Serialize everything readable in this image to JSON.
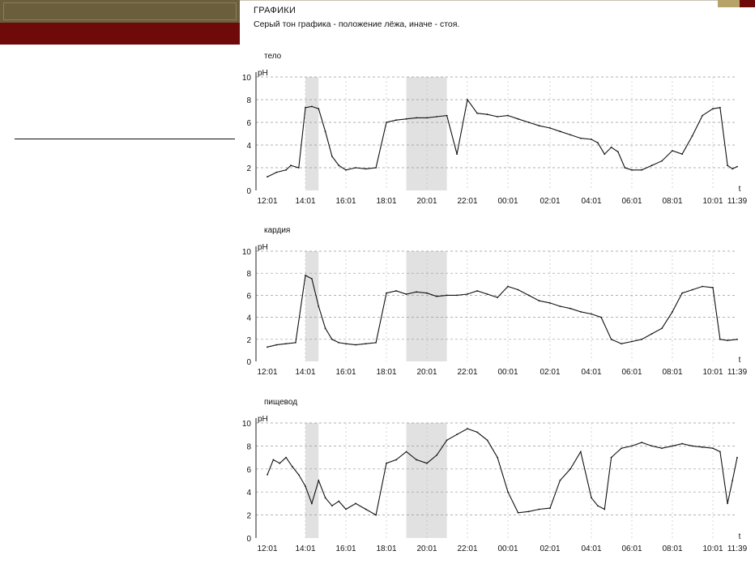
{
  "header": {
    "title": "ГРАФИКИ",
    "subtitle": "Серый тон графика - положение лёжа, иначе - стоя."
  },
  "colors": {
    "slide_band_dark": "#6a5e3c",
    "slide_band_red": "#6f0a0a",
    "trace": "#111111",
    "lying_shade": "#c8c8c8"
  },
  "chart_data": [
    {
      "type": "line",
      "title": "тело",
      "ylabel": "pH",
      "xlabel": "t",
      "ylim": [
        0,
        10
      ],
      "yticks": [
        "0",
        "2",
        "4",
        "6",
        "8",
        "10"
      ],
      "xticks": [
        "12:01",
        "14:01",
        "16:01",
        "18:01",
        "20:01",
        "22:01",
        "00:01",
        "02:01",
        "04:01",
        "06:01",
        "08:01",
        "10:01",
        "11:39"
      ],
      "grid": true,
      "x": [
        "12:01",
        "12:30",
        "13:00",
        "13:15",
        "13:40",
        "14:01",
        "14:20",
        "14:40",
        "15:00",
        "15:20",
        "15:40",
        "16:01",
        "16:30",
        "17:00",
        "17:30",
        "18:01",
        "18:30",
        "19:00",
        "19:30",
        "20:01",
        "20:30",
        "21:00",
        "21:30",
        "22:01",
        "22:30",
        "23:00",
        "23:30",
        "00:01",
        "00:30",
        "01:00",
        "01:30",
        "02:01",
        "02:30",
        "03:00",
        "03:30",
        "04:01",
        "04:20",
        "04:40",
        "05:00",
        "05:20",
        "05:40",
        "06:01",
        "06:30",
        "07:00",
        "07:30",
        "08:01",
        "08:30",
        "09:00",
        "09:30",
        "10:01",
        "10:30",
        "11:00",
        "11:20",
        "11:39"
      ],
      "values": [
        1.2,
        1.6,
        1.8,
        2.2,
        2.0,
        7.3,
        7.4,
        7.2,
        5.2,
        3.0,
        2.2,
        1.8,
        2.0,
        1.9,
        2.0,
        6.0,
        6.2,
        6.3,
        6.4,
        6.4,
        6.5,
        6.6,
        3.2,
        8.0,
        6.8,
        6.7,
        6.5,
        6.6,
        6.3,
        6.0,
        5.7,
        5.5,
        5.2,
        4.9,
        4.6,
        4.5,
        4.2,
        3.2,
        3.8,
        3.4,
        2.0,
        1.8,
        1.8,
        2.2,
        2.6,
        3.5,
        3.2,
        4.8,
        6.6,
        7.2,
        7.3,
        2.2,
        1.9,
        2.1
      ],
      "lying_periods": [
        [
          "14:01",
          "14:40"
        ],
        [
          "19:00",
          "21:00"
        ]
      ]
    },
    {
      "type": "line",
      "title": "кардия",
      "ylabel": "pH",
      "xlabel": "t",
      "ylim": [
        0,
        10
      ],
      "yticks": [
        "0",
        "2",
        "4",
        "6",
        "8",
        "10"
      ],
      "xticks": [
        "12:01",
        "14:01",
        "16:01",
        "18:01",
        "20:01",
        "22:01",
        "00:01",
        "02:01",
        "04:01",
        "06:01",
        "08:01",
        "10:01",
        "11:39"
      ],
      "grid": true,
      "x": [
        "12:01",
        "12:30",
        "13:00",
        "13:30",
        "14:01",
        "14:20",
        "14:40",
        "15:00",
        "15:20",
        "15:40",
        "16:01",
        "16:30",
        "17:00",
        "17:30",
        "18:01",
        "18:30",
        "19:00",
        "19:30",
        "20:01",
        "20:30",
        "21:00",
        "21:30",
        "22:01",
        "22:30",
        "23:00",
        "23:30",
        "00:01",
        "00:30",
        "01:00",
        "01:30",
        "02:01",
        "02:30",
        "03:00",
        "03:30",
        "04:01",
        "04:30",
        "05:00",
        "05:30",
        "06:01",
        "06:30",
        "07:00",
        "07:30",
        "08:01",
        "08:30",
        "09:00",
        "09:30",
        "10:01",
        "10:30",
        "11:00",
        "11:39"
      ],
      "values": [
        1.3,
        1.5,
        1.6,
        1.7,
        7.8,
        7.5,
        5.0,
        3.0,
        2.0,
        1.7,
        1.6,
        1.5,
        1.6,
        1.7,
        6.2,
        6.4,
        6.1,
        6.3,
        6.2,
        5.9,
        6.0,
        6.0,
        6.1,
        6.4,
        6.1,
        5.8,
        6.8,
        6.5,
        6.0,
        5.5,
        5.3,
        5.0,
        4.8,
        4.5,
        4.3,
        4.0,
        2.0,
        1.6,
        1.8,
        2.0,
        2.5,
        3.0,
        4.5,
        6.2,
        6.5,
        6.8,
        6.7,
        2.0,
        1.9,
        2.0
      ],
      "lying_periods": [
        [
          "14:01",
          "14:40"
        ],
        [
          "19:00",
          "21:00"
        ]
      ]
    },
    {
      "type": "line",
      "title": "пищевод",
      "ylabel": "pH",
      "xlabel": "t",
      "ylim": [
        0,
        10
      ],
      "yticks": [
        "0",
        "2",
        "4",
        "6",
        "8",
        "10"
      ],
      "xticks": [
        "12:01",
        "14:01",
        "16:01",
        "18:01",
        "20:01",
        "22:01",
        "00:01",
        "02:01",
        "04:01",
        "06:01",
        "08:01",
        "10:01",
        "11:39"
      ],
      "grid": true,
      "x": [
        "12:01",
        "12:20",
        "12:40",
        "13:00",
        "13:20",
        "13:40",
        "14:01",
        "14:20",
        "14:40",
        "15:00",
        "15:20",
        "15:40",
        "16:01",
        "16:30",
        "17:00",
        "17:30",
        "18:01",
        "18:30",
        "19:00",
        "19:30",
        "20:01",
        "20:30",
        "21:00",
        "21:30",
        "22:01",
        "22:30",
        "23:00",
        "23:30",
        "00:01",
        "00:30",
        "01:00",
        "01:30",
        "02:01",
        "02:30",
        "03:00",
        "03:30",
        "04:01",
        "04:20",
        "04:40",
        "05:00",
        "05:30",
        "06:01",
        "06:30",
        "07:00",
        "07:30",
        "08:01",
        "08:30",
        "09:00",
        "09:30",
        "10:01",
        "10:30",
        "11:00",
        "11:20",
        "11:39"
      ],
      "values": [
        5.5,
        6.8,
        6.5,
        7.0,
        6.2,
        5.5,
        4.5,
        3.0,
        5.0,
        3.5,
        2.8,
        3.2,
        2.5,
        3.0,
        2.5,
        2.0,
        6.5,
        6.8,
        7.5,
        6.8,
        6.5,
        7.2,
        8.5,
        9.0,
        9.5,
        9.2,
        8.5,
        7.0,
        4.0,
        2.2,
        2.3,
        2.5,
        2.6,
        5.0,
        6.0,
        7.5,
        3.5,
        2.8,
        2.5,
        7.0,
        7.8,
        8.0,
        8.3,
        8.0,
        7.8,
        8.0,
        8.2,
        8.0,
        7.9,
        7.8,
        7.5,
        3.0,
        5.0,
        7.0
      ],
      "lying_periods": [
        [
          "14:01",
          "14:40"
        ],
        [
          "19:00",
          "21:00"
        ]
      ]
    }
  ]
}
